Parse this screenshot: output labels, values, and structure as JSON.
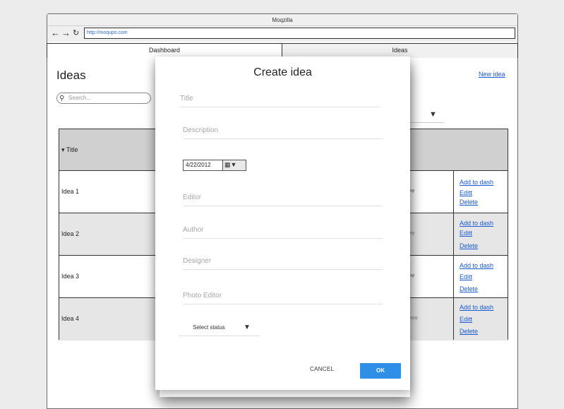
{
  "window": {
    "title": "Moqzilla"
  },
  "nav": {
    "back_icon": "arrow-left",
    "forward_icon": "arrow-right",
    "reload_icon": "reload",
    "url": "http://moqups.com"
  },
  "tabs": [
    {
      "label": "Dashboard"
    },
    {
      "label": "Ideas"
    }
  ],
  "page": {
    "title": "Ideas",
    "new_idea": "New idea",
    "search_placeholder": "Search..."
  },
  "table": {
    "header": "▾ Title",
    "rows": [
      {
        "name": "Idea 1",
        "actions": [
          "Add to dash",
          "Editt",
          "Delete"
        ]
      },
      {
        "name": "Idea 2",
        "actions": [
          "Add to dash",
          "Editt",
          "Delete"
        ]
      },
      {
        "name": "Idea 3",
        "actions": [
          "Add to dash",
          "Editt",
          "Delete"
        ]
      },
      {
        "name": "Idea 4",
        "actions": [
          "Add to dash",
          "Editt",
          "Delete"
        ]
      }
    ]
  },
  "modal": {
    "title": "Create idea",
    "fields": {
      "title": "Title",
      "description": "Description",
      "editor": "Editor",
      "author": "Author",
      "designer": "Designer",
      "photo_editor": "Photo Editor"
    },
    "date_value": "4/22/2012",
    "status_placeholder": "Select status",
    "cancel_label": "CANCEL",
    "ok_label": "OK"
  },
  "colors": {
    "accent": "#2f8ee5",
    "link": "#1a5ad6",
    "header_bg": "#d0d0d0"
  }
}
